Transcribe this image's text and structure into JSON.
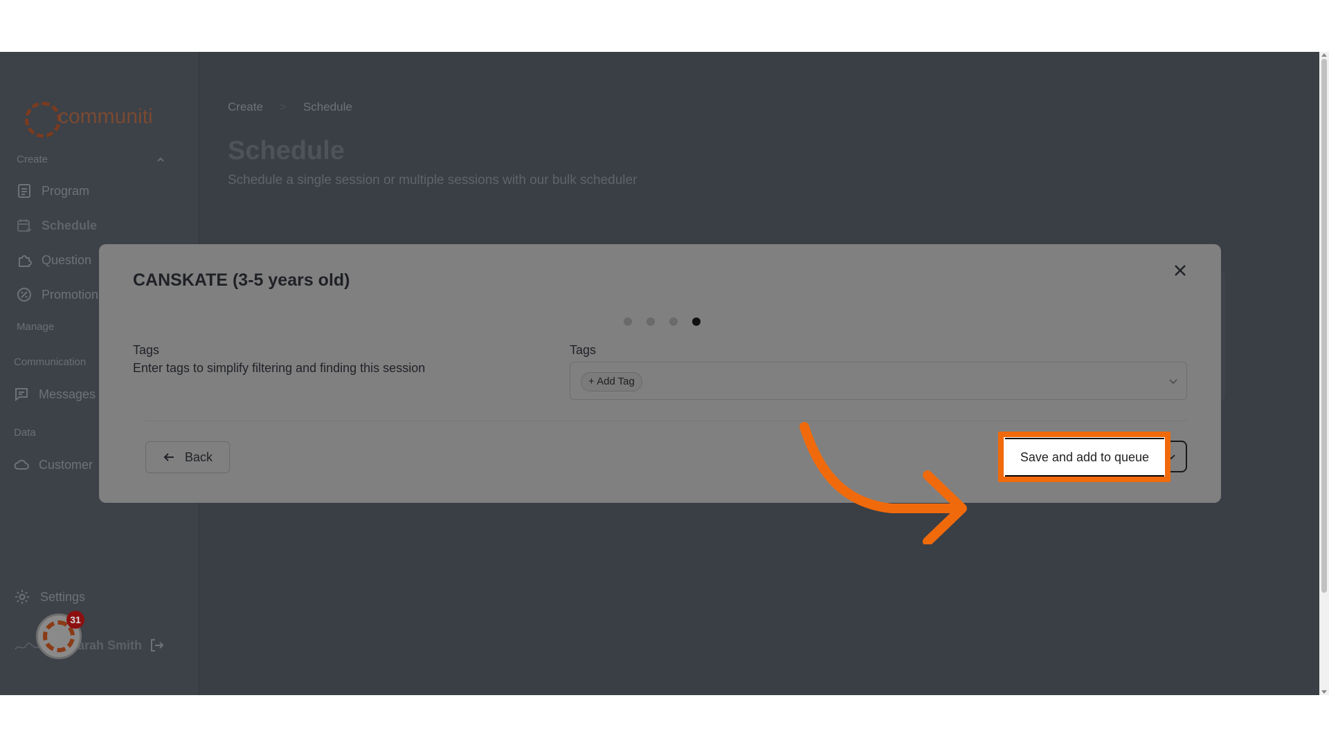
{
  "sidebar": {
    "logo_text": "communiti",
    "sections": {
      "create": "Create",
      "manage": "Manage",
      "communication": "Communication",
      "data": "Data"
    },
    "items": [
      {
        "label": "Program"
      },
      {
        "label": "Schedule"
      },
      {
        "label": "Question"
      },
      {
        "label": "Promotion"
      },
      {
        "label": "Messages"
      },
      {
        "label": "Customer"
      }
    ],
    "settings_label": "Settings",
    "user_name": "Sarah Smith",
    "help_badge_count": "31"
  },
  "header": {
    "breadcrumb": [
      "Create",
      "Schedule"
    ],
    "breadcrumb_sep": ">",
    "title": "Schedule",
    "subtitle": "Schedule a single session or multiple sessions with our bulk scheduler"
  },
  "modal": {
    "title": "CANSKATE (3-5 years old)",
    "steps_total": 4,
    "active_step": 4,
    "section_title": "Tags",
    "section_description": "Enter tags to simplify filtering and finding this session",
    "field_label": "Tags",
    "add_tag_label": "+ Add Tag",
    "back_label": "Back",
    "save_label": "Save and add to queue"
  },
  "colors": {
    "highlight": "#f06a0c",
    "brand": "#8a3a16"
  }
}
